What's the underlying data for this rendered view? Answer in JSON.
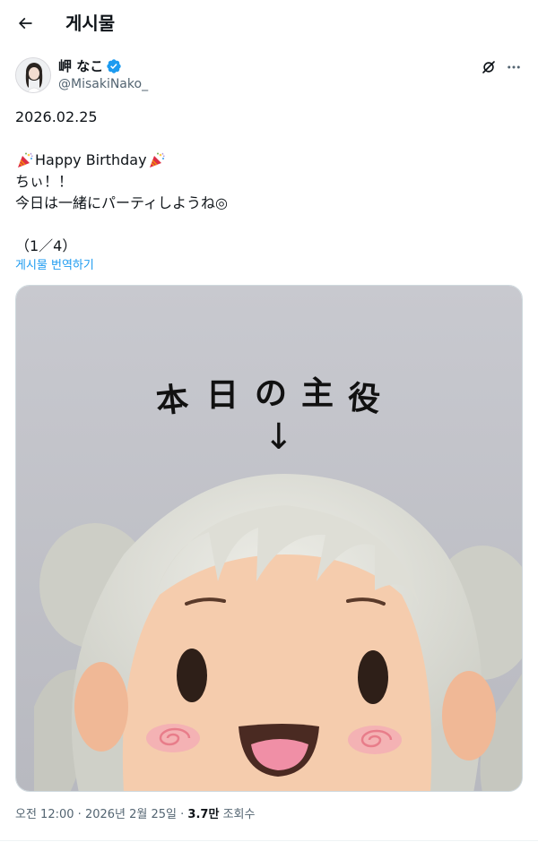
{
  "header": {
    "title": "게시물",
    "back_icon": "arrow-left-icon"
  },
  "author": {
    "display_name": "岬 なこ",
    "handle": "@MisakiNako_",
    "verified_color": "#1d9bf0"
  },
  "tweet": {
    "lines": [
      "2026.02.25",
      "",
      "Happy Birthday",
      "ちぃ！！",
      "今日は一緒にパーティしようね◎",
      "",
      "（1／4）"
    ],
    "translate_label": "게시물 번역하기"
  },
  "media": {
    "caption_chars": [
      "本",
      "日",
      "の",
      "主",
      "役"
    ],
    "arrow": "↓"
  },
  "meta": {
    "time": "오전 12:00",
    "date": "2026년 2월 25일",
    "views_count": "3.7만",
    "views_label": "조회수",
    "separator": "·"
  },
  "colors": {
    "accent": "#1d9bf0",
    "text": "#0f1419",
    "secondary": "#536471"
  }
}
